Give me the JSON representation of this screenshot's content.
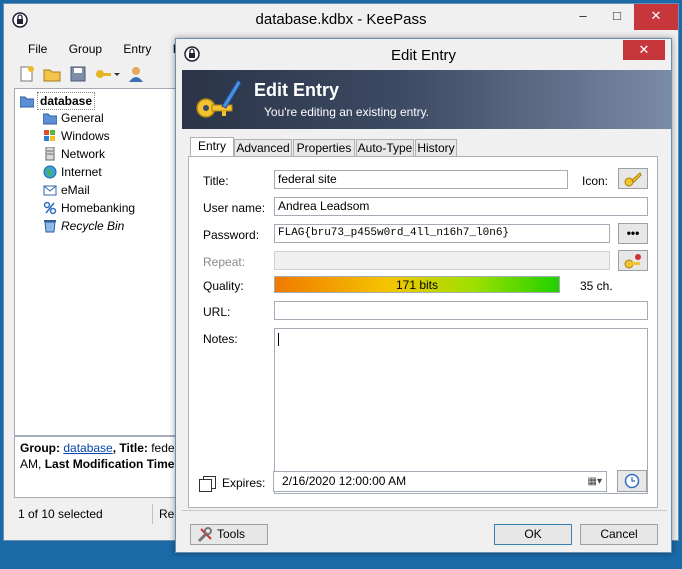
{
  "main_window": {
    "title": "database.kdbx - KeePass",
    "minimize": "–",
    "maximize": "□",
    "close": "✕",
    "menu": [
      "File",
      "Group",
      "Entry",
      "Fi"
    ],
    "tree": [
      {
        "label": "database",
        "bold": true
      },
      {
        "label": "General"
      },
      {
        "label": "Windows"
      },
      {
        "label": "Network"
      },
      {
        "label": "Internet"
      },
      {
        "label": "eMail"
      },
      {
        "label": "Homebanking"
      },
      {
        "label": "Recycle Bin",
        "italic": true
      }
    ],
    "status_group_label": "Group:",
    "status_group_link": "database",
    "status_title_label": "Title:",
    "status_title_value": "federa",
    "status_line2_prefix": "AM,",
    "status_modified_label": "Last Modification Time:",
    "selection_count": "1 of 10 selected",
    "status_right": "Rea"
  },
  "dialog": {
    "title": "Edit Entry",
    "close": "✕",
    "banner_title": "Edit Entry",
    "banner_subtitle": "You're editing an existing entry.",
    "tabs": [
      "Entry",
      "Advanced",
      "Properties",
      "Auto-Type",
      "History"
    ],
    "fields": {
      "title_label": "Title:",
      "title_value": "federal site",
      "icon_label": "Icon:",
      "username_label": "User name:",
      "username_value": "Andrea Leadsom",
      "password_label": "Password:",
      "password_value": "FLAG{bru73_p455w0rd_4ll_n16h7_l0n6}",
      "password_toggle": "•••",
      "repeat_label": "Repeat:",
      "repeat_value": "",
      "quality_label": "Quality:",
      "quality_text": "171 bits",
      "quality_fraction": 1.0,
      "quality_chars": "35 ch.",
      "url_label": "URL:",
      "url_value": "",
      "notes_label": "Notes:",
      "notes_value": "",
      "expires_label": "Expires:",
      "expires_checked": false,
      "expires_value": "2/16/2020 12:00:00 AM"
    },
    "tools_button": "Tools",
    "ok_button": "OK",
    "cancel_button": "Cancel"
  },
  "colors": {
    "desktop": "#1b6aa8",
    "close_red": "#c7363a",
    "link": "#0645ad"
  }
}
